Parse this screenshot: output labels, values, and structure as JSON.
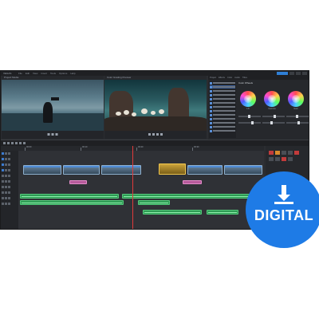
{
  "app": {
    "brand": "VEGAS",
    "menu": [
      "File",
      "Edit",
      "View",
      "Insert",
      "Tools",
      "Options",
      "Help"
    ]
  },
  "monitors": {
    "left_title": "Project Media",
    "right_title": "Color Grading Preview"
  },
  "right_panel": {
    "tabs": [
      "Project",
      "Effects",
      "Color",
      "Audio",
      "Titles"
    ],
    "section_title": "Color Wheels",
    "wheels": [
      "Lift",
      "Gamma",
      "Gain"
    ]
  },
  "timeline": {
    "markers": [
      "00:00",
      "00:10",
      "00:20",
      "00:30"
    ]
  },
  "badge": {
    "label": "DIGITAL",
    "icon": "download-icon",
    "color": "#1e7be6"
  },
  "colors": {
    "accent": "#2f7fd6",
    "playhead": "#e03a3a",
    "audio_clip": "#2f9b55",
    "title_clip": "#b55a9a",
    "selected_clip": "#caa23a"
  }
}
